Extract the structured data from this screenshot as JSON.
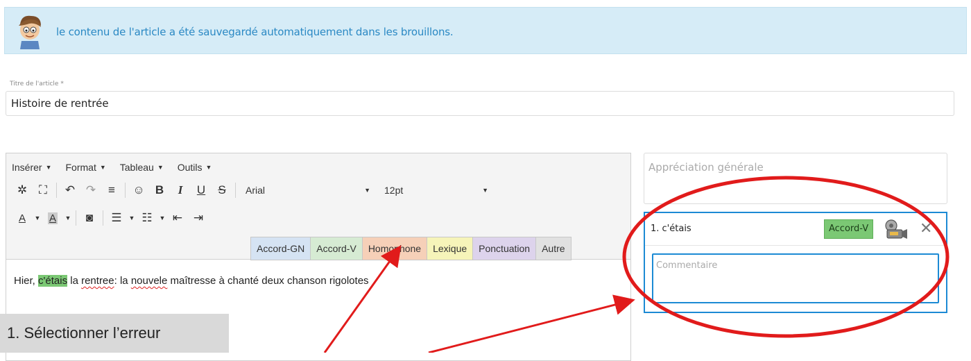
{
  "alert": {
    "message": "le contenu de l'article a été sauvegardé automatiquement dans les brouillons."
  },
  "title_field": {
    "label": "Titre de l'article *",
    "value": "Histoire de rentrée"
  },
  "menubar": [
    "Insérer",
    "Format",
    "Tableau",
    "Outils"
  ],
  "toolbar": {
    "font": "Arial",
    "size": "12pt"
  },
  "categories": [
    {
      "label": "Accord-GN",
      "color": "#d5e3f3"
    },
    {
      "label": "Accord-V",
      "color": "#d6ebd3"
    },
    {
      "label": "Homophone",
      "color": "#f6d0b8"
    },
    {
      "label": "Lexique",
      "color": "#f6f4b9"
    },
    {
      "label": "Ponctuation",
      "color": "#ddd3ec"
    },
    {
      "label": "Autre",
      "color": "#e1e1e1"
    }
  ],
  "content": {
    "p1": "Hier, ",
    "w_cetais": "c'étais",
    "p2": " la ",
    "w_rentree": "rentree",
    "p3": ": la ",
    "w_nouvele": "nouvele",
    "p4": " maîtresse à chanté deux chanson rigolotes"
  },
  "instruction": "1. Sélectionner l’erreur",
  "appreciation": {
    "placeholder": "Appréciation générale"
  },
  "annotation": {
    "title": "1. c'étais",
    "badge": "Accord-V",
    "comment_placeholder": "Commentaire"
  },
  "colors": {
    "annotation_red": "#e11b1b",
    "focus_blue": "#1c8ad4",
    "highlight_green": "#7bc874"
  }
}
